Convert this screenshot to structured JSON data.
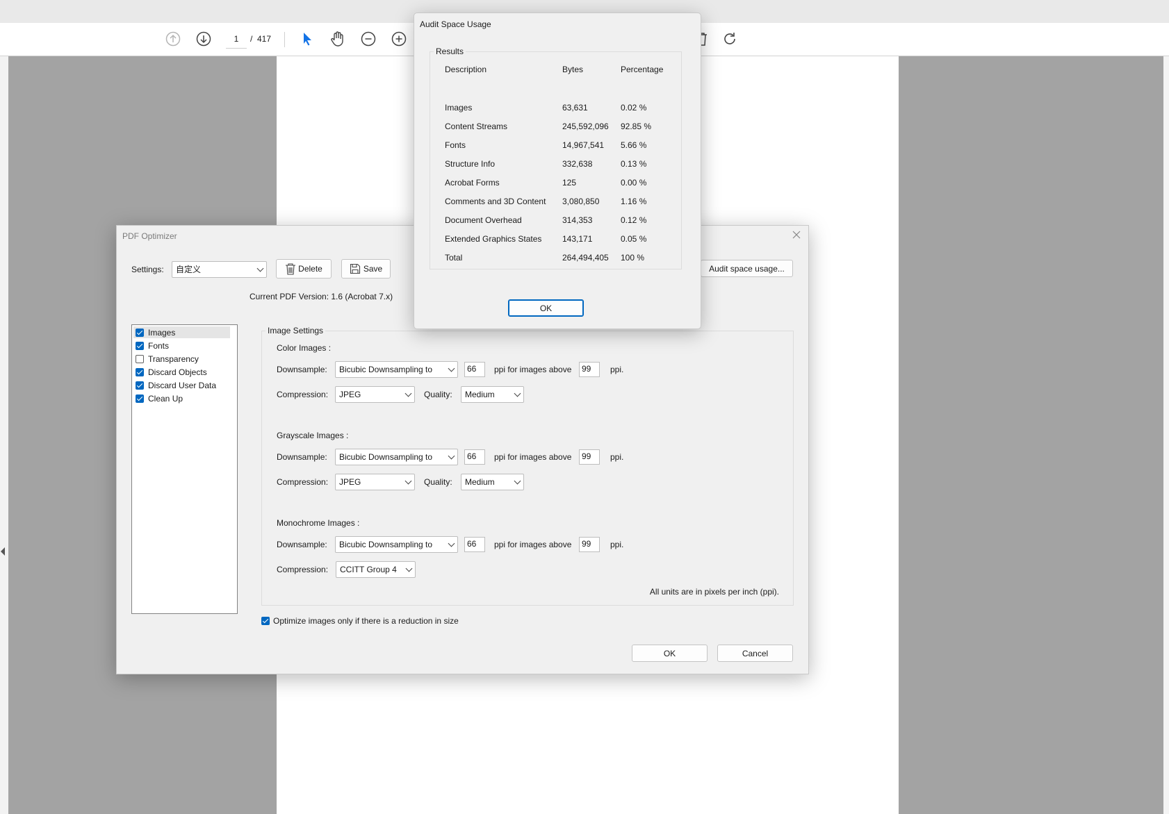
{
  "toolbar": {
    "page_current": "1",
    "page_separator": "/",
    "page_total": "417",
    "icons": [
      "prev-page-icon",
      "next-page-icon",
      "select-cursor-icon",
      "hand-tool-icon",
      "zoom-out-icon",
      "zoom-in-icon",
      "delete-icon",
      "rotate-icon"
    ]
  },
  "optimizer": {
    "title": "PDF Optimizer",
    "settings_label": "Settings:",
    "settings_value": "自定义",
    "delete_label": "Delete",
    "save_label": "Save",
    "audit_button": "Audit space usage...",
    "version_text": "Current PDF Version: 1.6 (Acrobat 7.x)",
    "panels": [
      {
        "label": "Images",
        "checked": true
      },
      {
        "label": "Fonts",
        "checked": true
      },
      {
        "label": "Transparency",
        "checked": false
      },
      {
        "label": "Discard Objects",
        "checked": true
      },
      {
        "label": "Discard User Data",
        "checked": true
      },
      {
        "label": "Clean Up",
        "checked": true
      }
    ],
    "image_settings": {
      "legend": "Image Settings",
      "color": {
        "heading": "Color Images :",
        "downsample_label": "Downsample:",
        "downsample_value": "Bicubic Downsampling to",
        "ppi": "66",
        "above_label": "ppi for images above",
        "above_value": "99",
        "ppi_suffix": "ppi.",
        "compression_label": "Compression:",
        "compression_value": "JPEG",
        "quality_label": "Quality:",
        "quality_value": "Medium"
      },
      "grayscale": {
        "heading": "Grayscale Images :",
        "downsample_label": "Downsample:",
        "downsample_value": "Bicubic Downsampling to",
        "ppi": "66",
        "above_label": "ppi for images above",
        "above_value": "99",
        "ppi_suffix": "ppi.",
        "compression_label": "Compression:",
        "compression_value": "JPEG",
        "quality_label": "Quality:",
        "quality_value": "Medium"
      },
      "monochrome": {
        "heading": "Monochrome Images :",
        "downsample_label": "Downsample:",
        "downsample_value": "Bicubic Downsampling to",
        "ppi": "66",
        "above_label": "ppi for images above",
        "above_value": "99",
        "ppi_suffix": "ppi.",
        "compression_label": "Compression:",
        "compression_value": "CCITT Group 4"
      },
      "units_note": "All units are in pixels per inch (ppi)."
    },
    "optimize_only_label": "Optimize images only if there is a reduction in size",
    "optimize_only_checked": true,
    "ok_label": "OK",
    "cancel_label": "Cancel"
  },
  "audit": {
    "title": "Audit Space Usage",
    "results_legend": "Results",
    "headers": [
      "Description",
      "Bytes",
      "Percentage"
    ],
    "rows": [
      [
        "Images",
        "63,631",
        "0.02 %"
      ],
      [
        "Content Streams",
        "245,592,096",
        "92.85 %"
      ],
      [
        "Fonts",
        "14,967,541",
        "5.66 %"
      ],
      [
        "Structure Info",
        "332,638",
        "0.13 %"
      ],
      [
        "Acrobat Forms",
        "125",
        "0.00 %"
      ],
      [
        "Comments and 3D Content",
        "3,080,850",
        "1.16 %"
      ],
      [
        "Document Overhead",
        "314,353",
        "0.12 %"
      ],
      [
        "Extended Graphics States",
        "143,171",
        "0.05 %"
      ],
      [
        "Total",
        "264,494,405",
        "100 %"
      ]
    ],
    "ok_label": "OK"
  },
  "colors": {
    "accent": "#0067c0",
    "select_tool": "#1473e6",
    "page_bg": "#a3a3a3",
    "dialog_bg": "#f0f0f0"
  }
}
